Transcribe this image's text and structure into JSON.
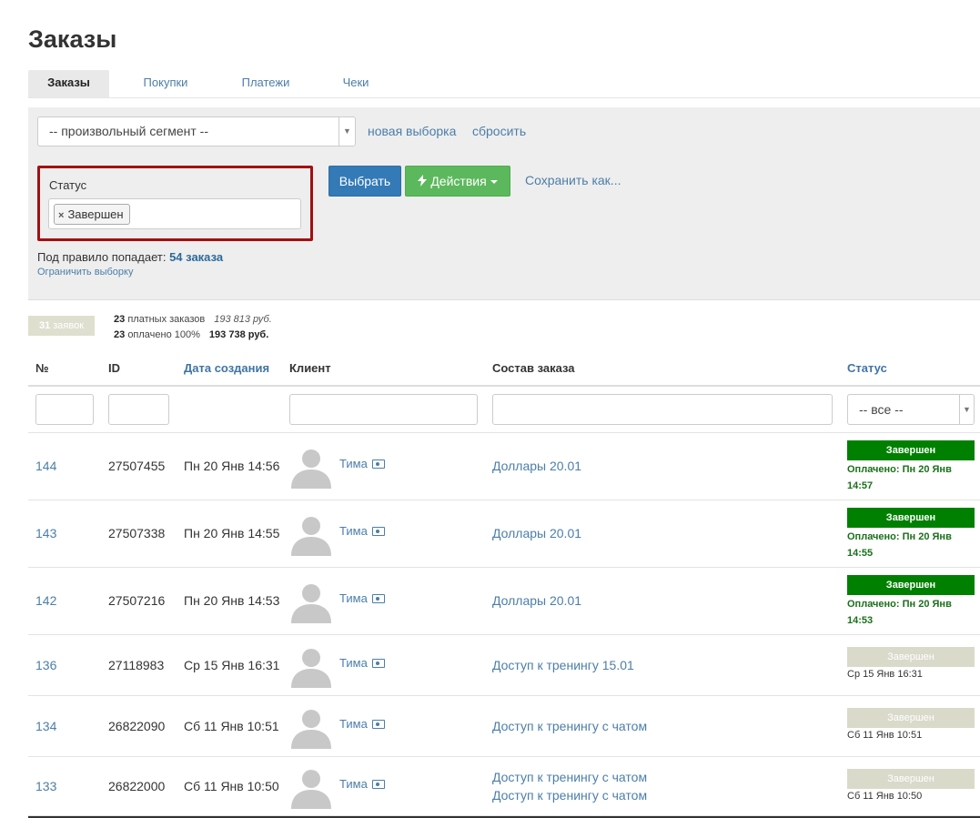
{
  "page_title": "Заказы",
  "tabs": [
    {
      "label": "Заказы",
      "active": true
    },
    {
      "label": "Покупки",
      "active": false
    },
    {
      "label": "Платежи",
      "active": false
    },
    {
      "label": "Чеки",
      "active": false
    }
  ],
  "filter": {
    "segment_value": "-- произвольный сегмент --",
    "new_selection_link": "новая выборка",
    "reset_link": "сбросить",
    "status_label": "Статус",
    "status_tag": "Завершен",
    "select_button": "Выбрать",
    "actions_button": "Действия",
    "save_as_link": "Сохранить как...",
    "rule_prefix": "Под правило попадает:",
    "rule_count": "54 заказа",
    "limit_link": "Ограничить выборку"
  },
  "summary": {
    "badge_count": "31",
    "badge_label": "заявок",
    "paid_orders_count": "23",
    "paid_orders_label": "платных заказов",
    "paid_orders_sum": "193 813 руб.",
    "paid_count": "23",
    "paid_label": "оплачено 100%",
    "paid_sum": "193 738 руб."
  },
  "table": {
    "headers": {
      "num": "№",
      "id": "ID",
      "date": "Дата создания",
      "client": "Клиент",
      "order": "Состав заказа",
      "status": "Статус"
    },
    "status_filter_value": "-- все --",
    "rows": [
      {
        "num": "144",
        "id": "27507455",
        "date": "Пн 20 Янв 14:56",
        "client": "Тима",
        "order": [
          "Доллары 20.01"
        ],
        "status": "Завершен",
        "paid": true,
        "status_info": "Оплачено: Пн 20 Янв 14:57"
      },
      {
        "num": "143",
        "id": "27507338",
        "date": "Пн 20 Янв 14:55",
        "client": "Тима",
        "order": [
          "Доллары 20.01"
        ],
        "status": "Завершен",
        "paid": true,
        "status_info": "Оплачено: Пн 20 Янв 14:55"
      },
      {
        "num": "142",
        "id": "27507216",
        "date": "Пн 20 Янв 14:53",
        "client": "Тима",
        "order": [
          "Доллары 20.01"
        ],
        "status": "Завершен",
        "paid": true,
        "status_info": "Оплачено: Пн 20 Янв 14:53"
      },
      {
        "num": "136",
        "id": "27118983",
        "date": "Ср 15 Янв 16:31",
        "client": "Тима",
        "order": [
          "Доступ к тренингу 15.01"
        ],
        "status": "Завершен",
        "paid": false,
        "status_info": "Ср 15 Янв 16:31"
      },
      {
        "num": "134",
        "id": "26822090",
        "date": "Сб 11 Янв 10:51",
        "client": "Тима",
        "order": [
          "Доступ к тренингу с чатом"
        ],
        "status": "Завершен",
        "paid": false,
        "status_info": "Сб 11 Янв 10:51"
      },
      {
        "num": "133",
        "id": "26822000",
        "date": "Сб 11 Янв 10:50",
        "client": "Тима",
        "order": [
          "Доступ к тренингу с чатом",
          "Доступ к тренингу с чатом"
        ],
        "status": "Завершен",
        "paid": false,
        "status_info": "Сб 11 Янв 10:50"
      }
    ]
  },
  "colors": {
    "link": "#4b7ea9",
    "status_green": "#008000",
    "status_grey": "#dadacb",
    "highlight_border": "#a30f12",
    "primary": "#337ab7",
    "success": "#5cb85c"
  }
}
